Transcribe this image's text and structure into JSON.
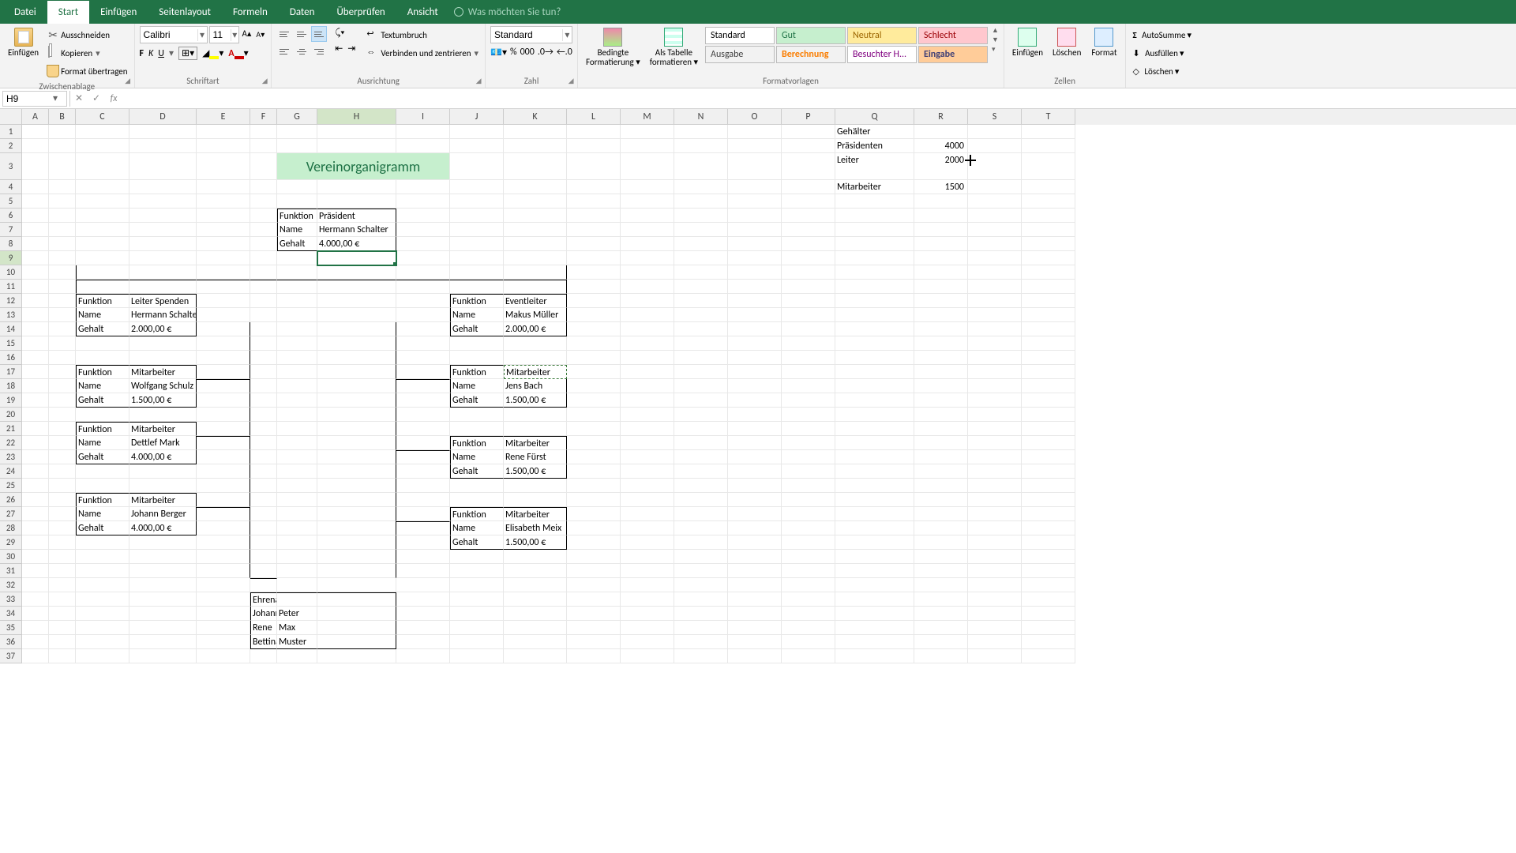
{
  "tabs": {
    "items": [
      "Datei",
      "Start",
      "Einfügen",
      "Seitenlayout",
      "Formeln",
      "Daten",
      "Überprüfen",
      "Ansicht"
    ],
    "active": 1,
    "tellme": "Was möchten Sie tun?"
  },
  "ribbon": {
    "clipboard": {
      "label": "Zwischenablage",
      "paste": "Einfügen",
      "cut": "Ausschneiden",
      "copy": "Kopieren",
      "painter": "Format übertragen"
    },
    "font": {
      "label": "Schriftart",
      "name": "Calibri",
      "size": "11",
      "b": "F",
      "i": "K",
      "u": "U"
    },
    "align": {
      "label": "Ausrichtung",
      "wrap": "Textumbruch",
      "merge": "Verbinden und zentrieren"
    },
    "number": {
      "label": "Zahl",
      "format": "Standard"
    },
    "cond": {
      "line1": "Bedingte",
      "line2": "Formatierung",
      "tbl1": "Als Tabelle",
      "tbl2": "formatieren"
    },
    "styles": {
      "label": "Formatvorlagen",
      "items": [
        {
          "t": "Standard",
          "bg": "#ffffff",
          "fg": "#000000"
        },
        {
          "t": "Gut",
          "bg": "#c6efce",
          "fg": "#1f7246"
        },
        {
          "t": "Neutral",
          "bg": "#ffeb9c",
          "fg": "#9c6500"
        },
        {
          "t": "Schlecht",
          "bg": "#ffc7ce",
          "fg": "#9c0006"
        },
        {
          "t": "Ausgabe",
          "bg": "#f2f2f2",
          "fg": "#3f3f3f"
        },
        {
          "t": "Berechnung",
          "bg": "#f2f2f2",
          "fg": "#fa7d00"
        },
        {
          "t": "Besuchter H...",
          "bg": "#ffffff",
          "fg": "#800080"
        },
        {
          "t": "Eingabe",
          "bg": "#ffcc99",
          "fg": "#3f3f76"
        }
      ]
    },
    "cells": {
      "label": "Zellen",
      "insert": "Einfügen",
      "delete": "Löschen",
      "format": "Format"
    },
    "editing": {
      "sum": "AutoSumme",
      "fill": "Ausfüllen",
      "clear": "Löschen"
    }
  },
  "namebox": "H9",
  "formula": "",
  "columns": [
    "A",
    "B",
    "C",
    "D",
    "E",
    "F",
    "G",
    "H",
    "I",
    "J",
    "K",
    "L",
    "M",
    "N",
    "O",
    "P",
    "Q",
    "R",
    "S",
    "T"
  ],
  "colWidths": {
    "A": 34,
    "B": 34,
    "C": 68,
    "D": 85,
    "E": 68,
    "F": 34,
    "G": 51,
    "H": 100,
    "I": 68,
    "J": 68,
    "K": 80,
    "L": 68,
    "M": 68,
    "N": 68,
    "O": 68,
    "P": 68,
    "Q": 100,
    "R": 68,
    "S": 68,
    "T": 68
  },
  "title": "Vereinorganigramm",
  "salary_table": {
    "header": "Gehälter",
    "rows": [
      {
        "label": "Präsidenten",
        "val": "4000"
      },
      {
        "label": "Leiter",
        "val": "2000"
      },
      {
        "label": "Mitarbeiter",
        "val": "1500"
      }
    ]
  },
  "boxes": {
    "president": {
      "funktion_l": "Funktion",
      "funktion": "Präsident",
      "name_l": "Name",
      "name": "Hermann Schalter",
      "gehalt_l": "Gehalt",
      "gehalt": "4.000,00 €"
    },
    "leader1": {
      "funktion_l": "Funktion",
      "funktion": "Leiter Spenden",
      "name_l": "Name",
      "name": "Hermann Schalter",
      "gehalt_l": "Gehalt",
      "gehalt": "2.000,00 €"
    },
    "leader2": {
      "funktion_l": "Funktion",
      "funktion": "Eventleiter",
      "name_l": "Name",
      "name": "Makus Müller",
      "gehalt_l": "Gehalt",
      "gehalt": "2.000,00 €"
    },
    "emp1": {
      "funktion_l": "Funktion",
      "funktion": "Mitarbeiter",
      "name_l": "Name",
      "name": "Wolfgang Schulz",
      "gehalt_l": "Gehalt",
      "gehalt": "1.500,00 €"
    },
    "emp2": {
      "funktion_l": "Funktion",
      "funktion": "Mitarbeiter",
      "name_l": "Name",
      "name": "Dettlef Mark",
      "gehalt_l": "Gehalt",
      "gehalt": "4.000,00 €"
    },
    "emp3": {
      "funktion_l": "Funktion",
      "funktion": "Mitarbeiter",
      "name_l": "Name",
      "name": "Johann Berger",
      "gehalt_l": "Gehalt",
      "gehalt": "4.000,00 €"
    },
    "emp4": {
      "funktion_l": "Funktion",
      "funktion": "Mitarbeiter",
      "name_l": "Name",
      "name": "Jens Bach",
      "gehalt_l": "Gehalt",
      "gehalt": "1.500,00 €"
    },
    "emp5": {
      "funktion_l": "Funktion",
      "funktion": "Mitarbeiter",
      "name_l": "Name",
      "name": "Rene Fürst",
      "gehalt_l": "Gehalt",
      "gehalt": "1.500,00 €"
    },
    "emp6": {
      "funktion_l": "Funktion",
      "funktion": "Mitarbeiter",
      "name_l": "Name",
      "name": "Elisabeth Meix",
      "gehalt_l": "Gehalt",
      "gehalt": "1.500,00 €"
    }
  },
  "volunteers": {
    "header": "Ehrenamtlichen Mitarbeiter",
    "rows": [
      [
        "Johann",
        "Peter"
      ],
      [
        "Rene",
        "Max"
      ],
      [
        "Bettina",
        "Muster"
      ]
    ]
  }
}
